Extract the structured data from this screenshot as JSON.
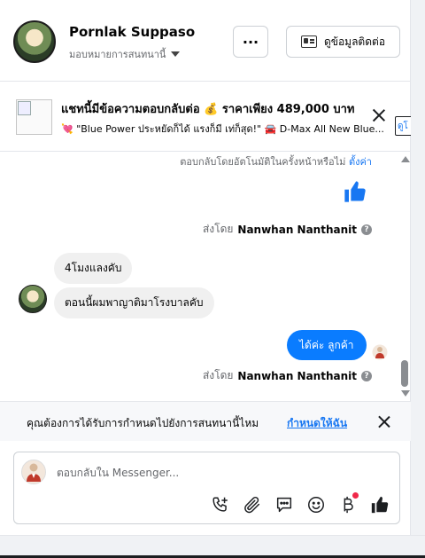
{
  "header": {
    "contact_name": "Pornlak Suppaso",
    "assign_label": "มอบหมายการสนทนานี้",
    "more_label": "···",
    "contact_info_label": "ดูข้อมูลติดต่อ"
  },
  "promo": {
    "title": "แชทนี้มีข้อความตอบกลับต่อ 💰 ราคาเพียง 489,000 บาท",
    "subtitle": "💘 \"Blue Power ประหยัดก็ได้ แรงก็มี เท่ก็สุด!\" 🚘 D-Max All New Blue...",
    "edge_label": "ดูโ"
  },
  "messages": {
    "auto_reply_note": "ตอบกลับโดยอัตโนมัติในครั้งหน้าหรือไม่",
    "auto_reply_link": "ตั้งค่า",
    "sent_by_prefix": "ส่งโดย",
    "sender_name": "Nanwhan Nanthanit",
    "incoming_1": "4โมงแลงคับ",
    "incoming_2": "ตอนนี้ผมพาญาติมาโรงบาลคับ",
    "outgoing_1": "ได้ค่ะ  ลูกค้า"
  },
  "reminder": {
    "text": "คุณต้องการได้รับการกำหนดไปยังการสนทนานี้ไหม",
    "link": "กำหนดให้ฉัน"
  },
  "composer": {
    "placeholder": "ตอบกลับใน Messenger..."
  },
  "icons": {
    "like": "thumbs-up-icon",
    "call": "phone-add-icon",
    "attach": "paperclip-icon",
    "saved_replies": "chat-bubble-icon",
    "emoji": "smiley-icon",
    "payment": "baht-icon"
  },
  "colors": {
    "accent": "#1877f2",
    "outgoing_bubble": "#0a7cff",
    "incoming_bubble": "#f0f0f0",
    "notification_dot": "#f02849"
  }
}
